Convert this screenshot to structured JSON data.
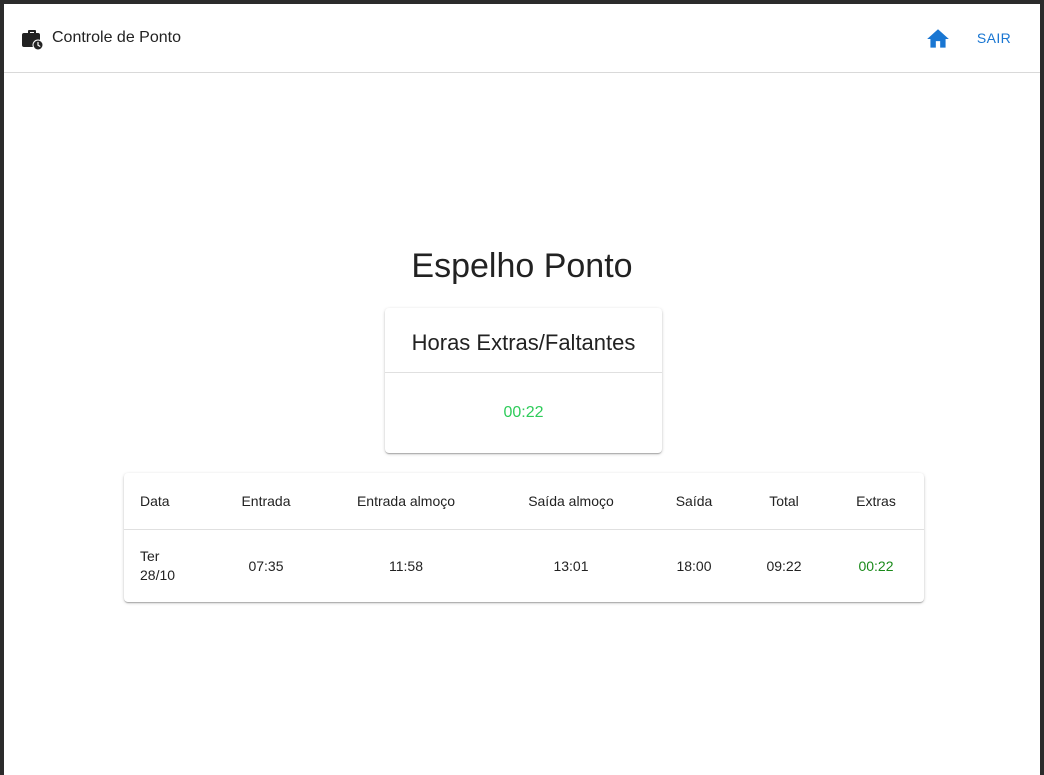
{
  "appbar": {
    "title": "Controle de Ponto",
    "brand_icon": "briefcase-clock-icon",
    "home_icon": "home-icon",
    "logout_label": "SAIR",
    "accent_color": "#1976d2"
  },
  "main": {
    "title": "Espelho Ponto",
    "summary": {
      "title": "Horas Extras/Faltantes",
      "value": "00:22",
      "value_color": "#2ecc5a"
    },
    "table": {
      "headers": [
        "Data",
        "Entrada",
        "Entrada almoço",
        "Saída almoço",
        "Saída",
        "Total",
        "Extras"
      ],
      "rows": [
        {
          "weekday": "Ter",
          "date": "28/10",
          "entrada": "07:35",
          "entrada_almoco": "11:58",
          "saida_almoco": "13:01",
          "saida": "18:00",
          "total": "09:22",
          "extras": "00:22",
          "extras_color": "#1a8a1a"
        }
      ]
    }
  }
}
